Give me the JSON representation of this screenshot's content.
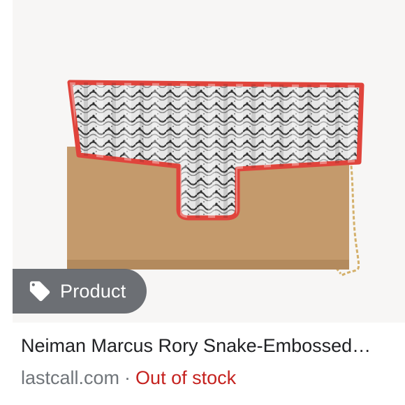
{
  "badge": {
    "label": "Product",
    "icon": "tag-icon"
  },
  "result": {
    "title": "Neiman Marcus Rory Snake-Embossed…",
    "source": "lastcall.com",
    "separator": "·",
    "status": "Out of stock"
  },
  "colors": {
    "status": "#c5221f",
    "badge_bg": "#5f6368",
    "bag_body": "#c49a6c",
    "bag_trim": "#e0443c",
    "chain": "#d4b06a"
  }
}
